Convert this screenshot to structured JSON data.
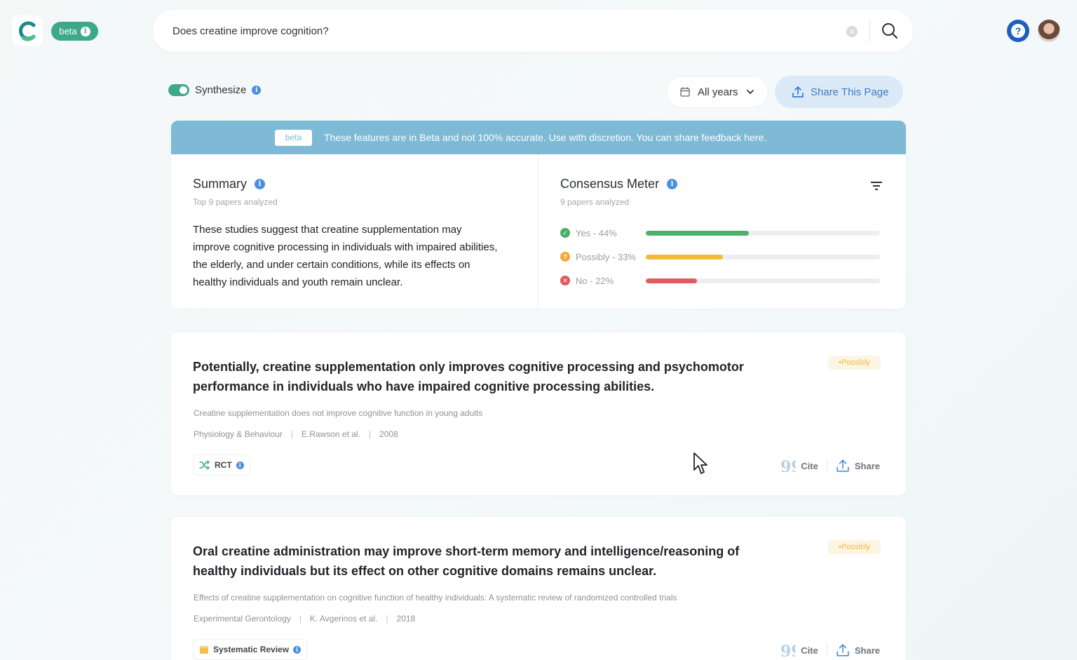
{
  "header": {
    "beta_label": "beta",
    "search_value": "Does creatine improve cognition?"
  },
  "controls": {
    "synthesize_label": "Synthesize",
    "synthesize_on": true,
    "years_label": "All years",
    "share_page_label": "Share This Page"
  },
  "banner": {
    "tag": "beta",
    "text": "These features are in Beta and not 100% accurate. Use with discretion. You can share feedback here."
  },
  "summary": {
    "title": "Summary",
    "subtitle": "Top 9 papers analyzed",
    "text": "These studies suggest that creatine supplementation may improve cognitive processing in individuals with impaired abilities, the elderly, and under certain conditions, while its effects on healthy individuals and youth remain unclear."
  },
  "consensus": {
    "title": "Consensus Meter",
    "subtitle": "9 papers analyzed",
    "rows": [
      {
        "label": "Yes - 44%",
        "percent": 44,
        "color": "#4caf6a"
      },
      {
        "label": "Possibly - 33%",
        "percent": 33,
        "color": "#f2b93b"
      },
      {
        "label": "No - 22%",
        "percent": 22,
        "color": "#e05a5f"
      }
    ]
  },
  "papers": [
    {
      "claim": "Potentially, creatine supplementation only improves cognitive processing and psychomotor performance in individuals who have impaired cognitive processing abilities.",
      "badge": "•Possibly",
      "title": "Creatine supplementation does not improve cognitive function  in young adults",
      "journal": "Physiology & Behaviour",
      "authors": "E.Rawson et al.",
      "year": "2008",
      "type": "RCT",
      "cite_label": "Cite",
      "share_label": "Share"
    },
    {
      "claim": "Oral creatine administration may improve short-term memory and intelligence/reasoning of healthy individuals but its effect on other cognitive domains remains unclear.",
      "badge": "•Possibly",
      "title": "Effects of creatine supplementation on cognitive function of healthy individuals: A systematic review of randomized controlled trials",
      "journal": "Experimental Gerontology",
      "authors": "K. Avgerinos et al.",
      "year": "2018",
      "type": "Systematic Review",
      "cite_label": "Cite",
      "share_label": "Share"
    }
  ],
  "meta_separator": "|",
  "colors": {
    "brand_green": "#3fa88a",
    "banner_blue": "#7eb9d6",
    "link_blue": "#3b7bc8"
  }
}
